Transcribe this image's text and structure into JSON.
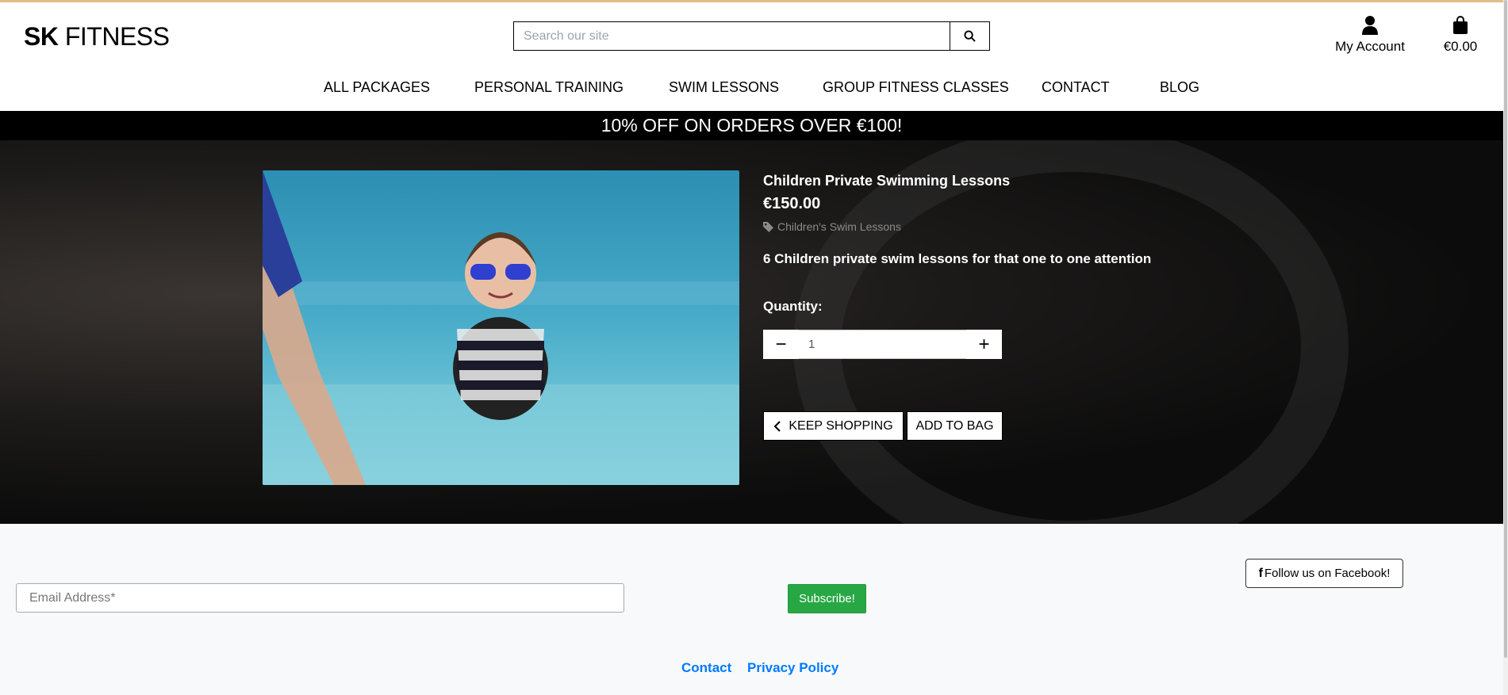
{
  "header": {
    "logo_bold": "SK",
    "logo_rest": " FITNESS",
    "search_placeholder": "Search our site",
    "account_label": "My Account",
    "bag_total": "€0.00"
  },
  "nav": [
    "ALL PACKAGES",
    "PERSONAL TRAINING",
    "SWIM LESSONS",
    "GROUP FITNESS CLASSES",
    "CONTACT",
    "BLOG"
  ],
  "banner": "10% OFF ON ORDERS OVER €100!",
  "product": {
    "name": "Children Private Swimming Lessons",
    "price": "€150.00",
    "category": "Children's Swim Lessons",
    "description": "6 Children private swim lessons for that one to one attention",
    "quantity_label": "Quantity:",
    "quantity": "1",
    "keep_shopping": "KEEP SHOPPING",
    "add_to_bag": "ADD TO BAG"
  },
  "footer": {
    "email_placeholder": "Email Address*",
    "subscribe": "Subscribe!",
    "facebook": "Follow us on Facebook!",
    "links": [
      "Contact",
      "Privacy Policy"
    ]
  },
  "colors": {
    "accent_top": "#e3bd8a",
    "subscribe": "#28a745",
    "link": "#007bff"
  }
}
